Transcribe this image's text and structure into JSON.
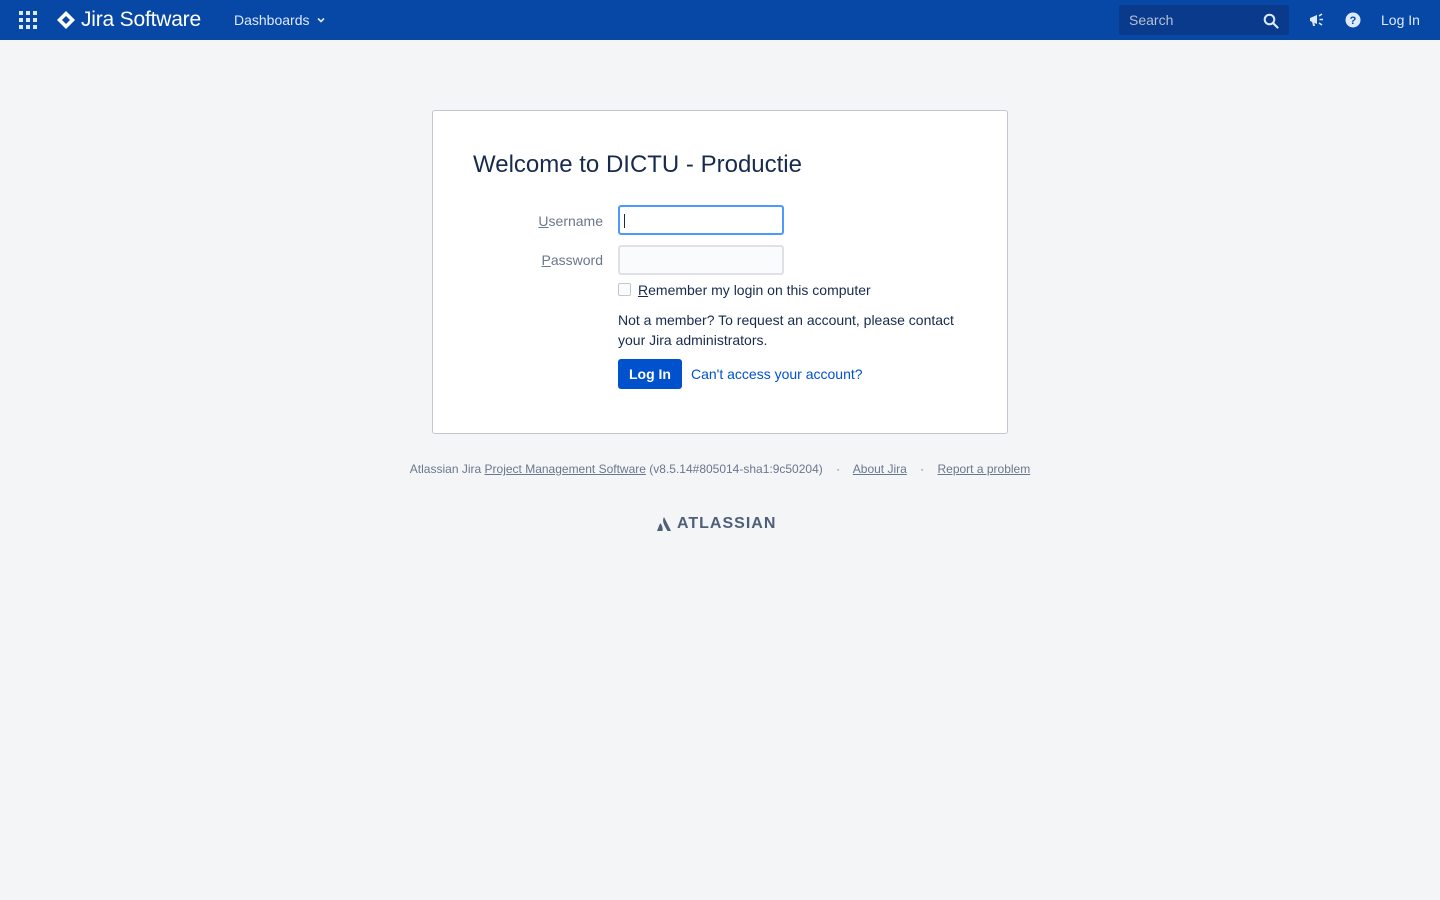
{
  "header": {
    "product_name": "Jira Software",
    "nav_dashboards": "Dashboards",
    "search_placeholder": "Search",
    "login_link": "Log In"
  },
  "login": {
    "title": "Welcome to DICTU - Productie",
    "username_label_first": "U",
    "username_label_rest": "sername",
    "password_label_first": "P",
    "password_label_rest": "assword",
    "username_value": "",
    "password_value": "",
    "remember_first": "R",
    "remember_rest": "emember my login on this computer",
    "remember_checked": false,
    "member_text": "Not a member? To request an account, please contact your Jira administrators.",
    "login_button": "Log In",
    "cant_access": "Can't access your account?"
  },
  "footer": {
    "prefix": "Atlassian Jira",
    "pm_link": "Project Management Software",
    "version": "(v8.5.14#805014-sha1:9c50204)",
    "separator": "·",
    "about": "About Jira",
    "report": "Report a problem",
    "brand": "ATLASSIAN"
  },
  "colors": {
    "header_bg": "#0747a6",
    "primary": "#0052cc",
    "page_bg": "#f4f5f7"
  }
}
